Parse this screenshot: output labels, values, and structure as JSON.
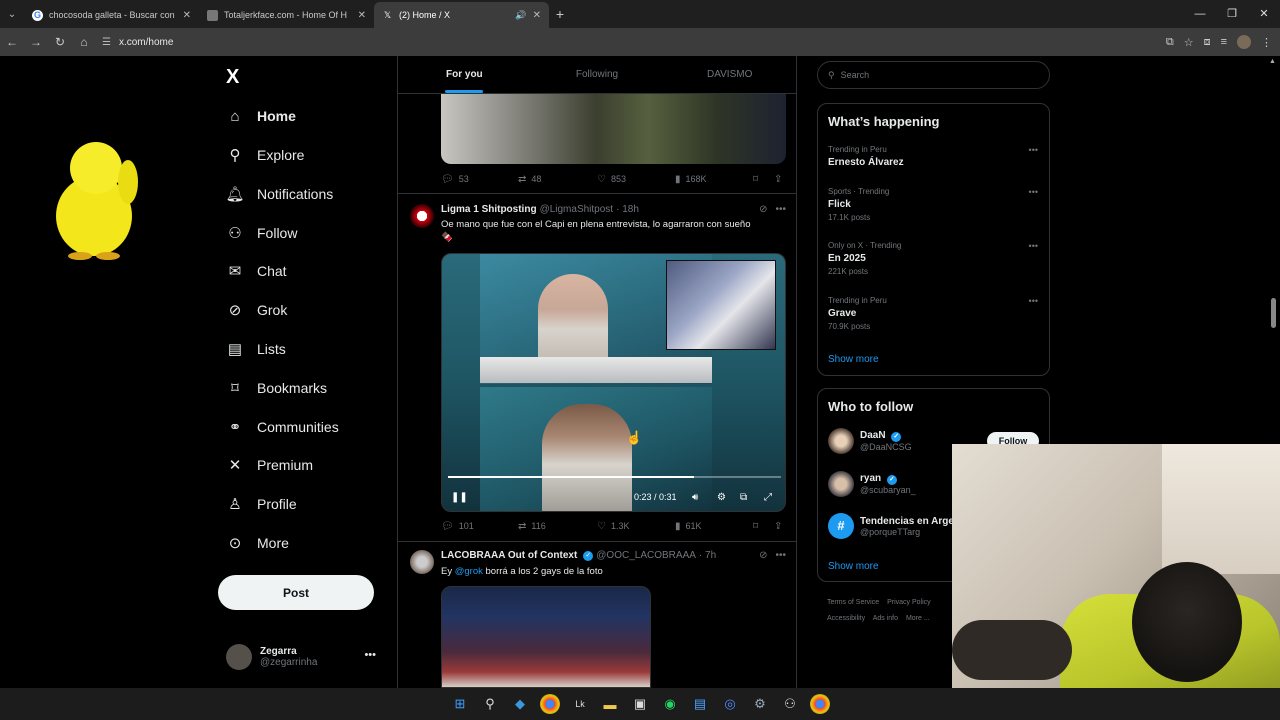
{
  "browser": {
    "tabs": [
      {
        "title": "chocosoda galleta - Buscar con",
        "icon": "google-icon",
        "active": false
      },
      {
        "title": "Totaljerkface.com - Home Of H",
        "icon": "page-icon",
        "active": false
      },
      {
        "title": "(2) Home / X",
        "icon": "x-icon",
        "active": true
      }
    ],
    "url": "x.com/home"
  },
  "nav": {
    "logo": "X",
    "items": [
      {
        "label": "Home",
        "icon": "home-icon"
      },
      {
        "label": "Explore",
        "icon": "search-icon"
      },
      {
        "label": "Notifications",
        "icon": "bell-icon"
      },
      {
        "label": "Follow",
        "icon": "follow-icon"
      },
      {
        "label": "Chat",
        "icon": "mail-icon"
      },
      {
        "label": "Grok",
        "icon": "grok-icon"
      },
      {
        "label": "Lists",
        "icon": "list-icon"
      },
      {
        "label": "Bookmarks",
        "icon": "bookmark-icon"
      },
      {
        "label": "Communities",
        "icon": "communities-icon"
      },
      {
        "label": "Premium",
        "icon": "x-icon"
      },
      {
        "label": "Profile",
        "icon": "person-icon"
      },
      {
        "label": "More",
        "icon": "more-icon"
      }
    ],
    "post_label": "Post",
    "me": {
      "name": "Zegarra",
      "handle": "@zegarrinha"
    }
  },
  "timeline": {
    "tabs": [
      "For you",
      "Following",
      "DAVISMO"
    ],
    "post0_actions": {
      "replies": "53",
      "reposts": "48",
      "likes": "853",
      "views": "168K"
    },
    "post1": {
      "name": "Ligma 1 Shitposting",
      "handle": "@LigmaShitpost",
      "time": "· 18h",
      "text": "Oe mano que fue con el Capi en plena entrevista, lo agarraron con sueño",
      "emoji": "🍫",
      "video_time": "0:23 / 0:31",
      "video_progress": 0.74,
      "actions": {
        "replies": "101",
        "reposts": "116",
        "likes": "1.3K",
        "views": "61K"
      }
    },
    "post2": {
      "name": "LACOBRAAA Out of Context",
      "handle": "@OOC_LACOBRAAA",
      "time": "· 7h",
      "text_prefix": "Ey ",
      "mention": "@grok",
      "text_suffix": " borrá a los 2 gays de la foto"
    }
  },
  "right": {
    "search_placeholder": "Search",
    "happening_title": "What’s happening",
    "trends": [
      {
        "meta": "Trending in Peru",
        "name": "Ernesto Álvarez",
        "count": ""
      },
      {
        "meta": "Sports · Trending",
        "name": "Flick",
        "count": "17.1K posts"
      },
      {
        "meta": "Only on X · Trending",
        "name": "En 2025",
        "count": "221K posts"
      },
      {
        "meta": "Trending in Peru",
        "name": "Grave",
        "count": "70.9K posts"
      }
    ],
    "show_more": "Show more",
    "wtf_title": "Who to follow",
    "follow_label": "Follow",
    "who_to_follow": [
      {
        "name": "DaaN",
        "handle": "@DaaNCSG"
      },
      {
        "name": "ryan",
        "handle": "@scubaryan_"
      },
      {
        "name": "Tendencias en Arge",
        "handle": "@porqueTTarg"
      }
    ],
    "footer": [
      "Terms of Service",
      "Privacy Policy",
      "Accessibility",
      "Ads info",
      "More ..."
    ]
  }
}
